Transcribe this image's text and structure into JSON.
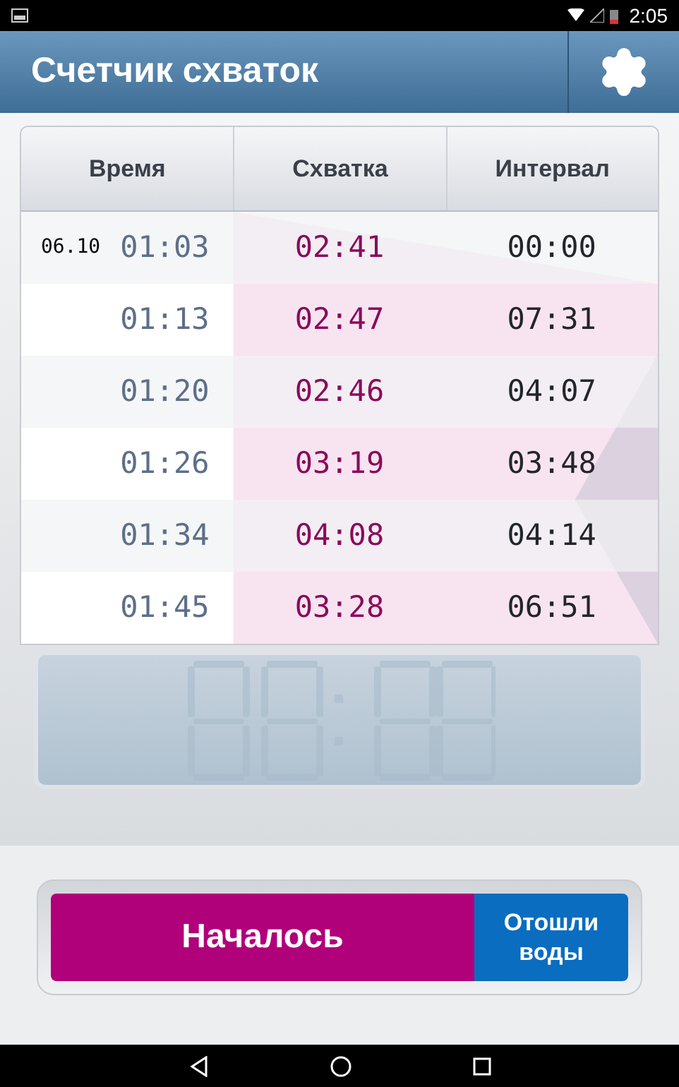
{
  "status_bar": {
    "time": "2:05"
  },
  "app_bar": {
    "title": "Счетчик схваток"
  },
  "table": {
    "columns": [
      "Время",
      "Схватка",
      "Интервал"
    ],
    "rows": [
      {
        "date": "06.10",
        "time": "01:03",
        "duration": "02:41",
        "interval": "00:00"
      },
      {
        "time": "01:13",
        "duration": "02:47",
        "interval": "07:31"
      },
      {
        "time": "01:20",
        "duration": "02:46",
        "interval": "04:07"
      },
      {
        "time": "01:26",
        "duration": "03:19",
        "interval": "03:48"
      },
      {
        "time": "01:34",
        "duration": "04:08",
        "interval": "04:14"
      },
      {
        "time": "01:45",
        "duration": "03:28",
        "interval": "06:51"
      }
    ]
  },
  "buttons": [
    {
      "label": "Началось",
      "kind": "start"
    },
    {
      "label": "Отошли воды",
      "kind": "water"
    }
  ]
}
